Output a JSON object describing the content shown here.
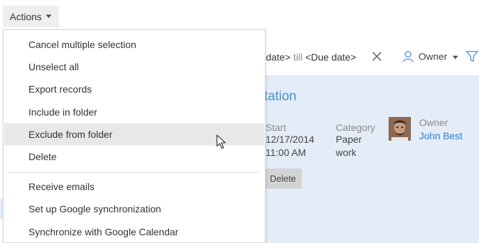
{
  "toolbar": {
    "actions_label": "Actions"
  },
  "filter": {
    "start_date_fragment": "rt date>",
    "till_label": "till",
    "due_date_label": "<Due date>",
    "owner_label": "Owner"
  },
  "card": {
    "title_fragment": "tation",
    "start_label": "Start",
    "start_date": "12/17/2014",
    "start_time": "11:00 AM",
    "category_label": "Category",
    "category_line1": "Paper",
    "category_line2": "work",
    "owner_label": "Owner",
    "owner_name": "John Best",
    "delete_label": "Delete"
  },
  "menu": {
    "items": [
      {
        "label": "Cancel multiple selection"
      },
      {
        "label": "Unselect all"
      },
      {
        "label": "Export records"
      },
      {
        "label": "Include in folder"
      },
      {
        "label": "Exclude from folder"
      },
      {
        "label": "Delete"
      },
      {
        "label": "Receive emails"
      },
      {
        "label": "Set up Google synchronization"
      },
      {
        "label": "Synchronize with Google Calendar"
      }
    ],
    "hovered_item": "Exclude from folder"
  },
  "colors": {
    "accent": "#4a90d2",
    "link": "#2a7fcb",
    "card_background": "#e4ecf8",
    "hover_background": "#e8e8e8"
  }
}
